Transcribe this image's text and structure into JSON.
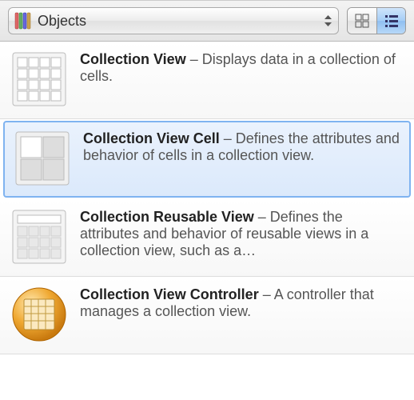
{
  "toolbar": {
    "dropdown_label": "Objects",
    "view_mode": "list"
  },
  "items": [
    {
      "title": "Collection View",
      "desc": " – Displays data in a collection of cells.",
      "icon": "grid-icon",
      "selected": false
    },
    {
      "title": "Collection View Cell",
      "desc": " – Defines the attributes and behavior of cells in a collection view.",
      "icon": "cell-icon",
      "selected": true
    },
    {
      "title": "Collection Reusable View",
      "desc": " – Defines the attributes and behavior of reusable views in a collection view, such as a…",
      "icon": "reusable-icon",
      "selected": false
    },
    {
      "title": "Collection View Controller",
      "desc": " – A controller that manages a collection view.",
      "icon": "controller-icon",
      "selected": false
    }
  ]
}
